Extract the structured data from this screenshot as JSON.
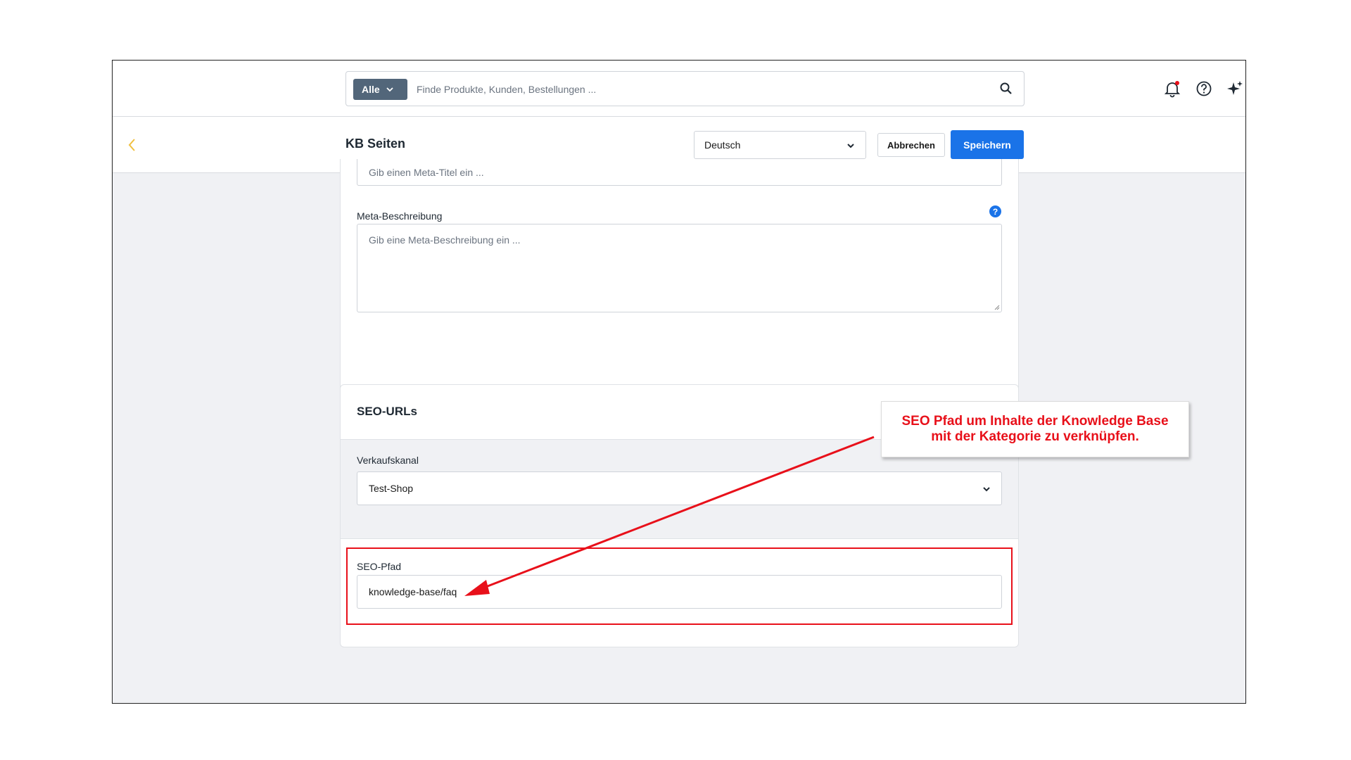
{
  "search": {
    "filter_label": "Alle",
    "placeholder": "Finde Produkte, Kunden, Bestellungen ..."
  },
  "header": {
    "title": "KB Seiten",
    "language": "Deutsch",
    "cancel_label": "Abbrechen",
    "save_label": "Speichern"
  },
  "meta": {
    "title_placeholder": "Gib einen Meta-Titel ein ...",
    "description_label": "Meta-Beschreibung",
    "description_placeholder": "Gib eine Meta-Beschreibung ein ...",
    "help_glyph": "?"
  },
  "seo": {
    "title": "SEO-URLs",
    "channel_label": "Verkaufskanal",
    "channel_value": "Test-Shop",
    "path_label": "SEO-Pfad",
    "path_value": "knowledge-base/faq"
  },
  "annotation": {
    "callout_line1": "SEO Pfad um Inhalte der Knowledge Base",
    "callout_line2": "mit der Kategorie zu verknüpfen.",
    "color": "#e8101a"
  },
  "colors": {
    "primary": "#1a73e8",
    "filter_bg": "#52667a",
    "back_accent": "#f0c040"
  }
}
